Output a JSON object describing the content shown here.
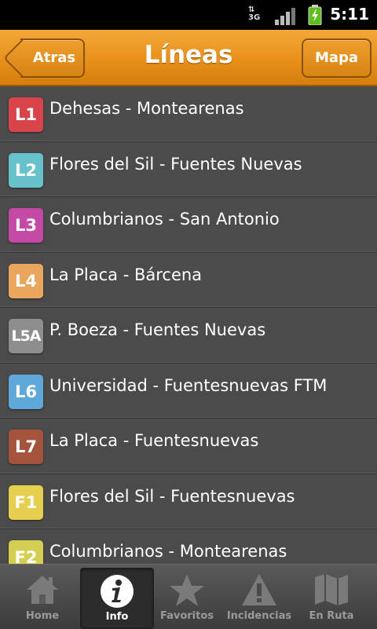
{
  "status_bar": {
    "time": "5:11",
    "network": "3G"
  },
  "header": {
    "title": "Líneas",
    "back_label": "Atras",
    "map_label": "Mapa"
  },
  "lines": [
    {
      "code": "L1",
      "name": "Dehesas - Montearenas",
      "color": "#d9434a"
    },
    {
      "code": "L2",
      "name": "Flores del Sil - Fuentes Nuevas",
      "color": "#67c2cc"
    },
    {
      "code": "L3",
      "name": "Columbrianos - San Antonio",
      "color": "#c54aa6"
    },
    {
      "code": "L4",
      "name": "La Placa - Bárcena",
      "color": "#e9a65c"
    },
    {
      "code": "L5A",
      "name": "P. Boeza - Fuentes Nuevas",
      "color": "#8e8e8e"
    },
    {
      "code": "L6",
      "name": "Universidad - Fuentesnuevas FTM",
      "color": "#5fa8da"
    },
    {
      "code": "L7",
      "name": "La Placa - Fuentesnuevas",
      "color": "#a4533d"
    },
    {
      "code": "F1",
      "name": "Flores del Sil - Fuentesnuevas",
      "color": "#e6cf4e"
    },
    {
      "code": "F2",
      "name": "Columbrianos - Montearenas",
      "color": "#d4cf53"
    }
  ],
  "tabs": [
    {
      "label": "Home",
      "icon": "home-icon",
      "active": false
    },
    {
      "label": "Info",
      "icon": "info-icon",
      "active": true
    },
    {
      "label": "Favoritos",
      "icon": "star-icon",
      "active": false
    },
    {
      "label": "Incidencias",
      "icon": "warning-icon",
      "active": false
    },
    {
      "label": "En Ruta",
      "icon": "map-icon",
      "active": false
    }
  ]
}
